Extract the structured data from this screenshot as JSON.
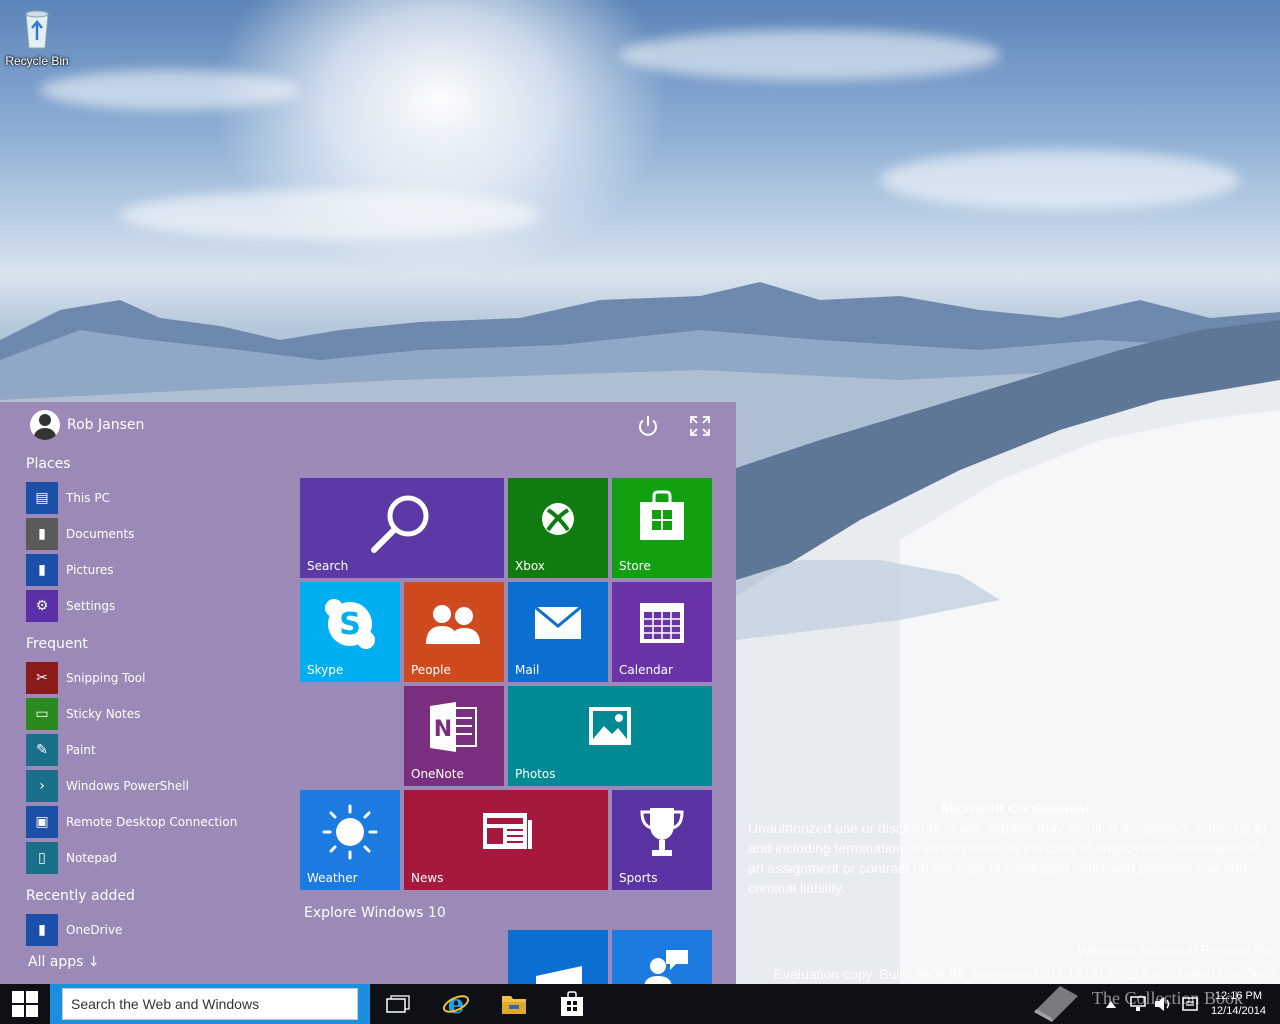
{
  "desktop": {
    "recycle_bin_label": "Recycle Bin",
    "watermark": {
      "title": "Microsoft Confidential",
      "body": "Unauthorized use or disclosure in any manner may result in disciplinary action up to and including termination of employment (in the case of employees), termination of an assignment or contract (in the case of contingent staff), and potential civil and criminal liability."
    },
    "build_line1": "Windows Technical Preview Pro",
    "build_line2": "Evaluation copy. Build 9909.fbl_awesome1501.141213-2119.d251e8ed37a50bc9",
    "brand_text": "The Collection Book"
  },
  "start_menu": {
    "user_name": "Rob Jansen",
    "background": "#9c89b7",
    "places_heading": "Places",
    "places": [
      {
        "label": "This PC",
        "icon": "computer-icon",
        "color": "#1c4fa8"
      },
      {
        "label": "Documents",
        "icon": "documents-icon",
        "color": "#5a5a5a"
      },
      {
        "label": "Pictures",
        "icon": "pictures-icon",
        "color": "#1c4fa8"
      },
      {
        "label": "Settings",
        "icon": "gear-icon",
        "color": "#5b2fa6"
      }
    ],
    "frequent_heading": "Frequent",
    "frequent": [
      {
        "label": "Snipping Tool",
        "icon": "scissors-icon",
        "color": "#8b1a1a"
      },
      {
        "label": "Sticky Notes",
        "icon": "sticky-note-icon",
        "color": "#2b8a1e"
      },
      {
        "label": "Paint",
        "icon": "palette-icon",
        "color": "#1c6f8a"
      },
      {
        "label": "Windows PowerShell",
        "icon": "powershell-icon",
        "color": "#1c6f8a"
      },
      {
        "label": "Remote Desktop Connection",
        "icon": "remote-desktop-icon",
        "color": "#1c4fa8"
      },
      {
        "label": "Notepad",
        "icon": "notepad-icon",
        "color": "#1c6f8a"
      }
    ],
    "recent_heading": "Recently added",
    "recent": [
      {
        "label": "OneDrive",
        "icon": "onedrive-icon",
        "color": "#1c4fa8"
      }
    ],
    "all_apps_label": "All apps ↓",
    "explore_label": "Explore Windows 10",
    "tiles": [
      {
        "label": "Search",
        "icon": "search-icon",
        "color": "#5b3aa6"
      },
      {
        "label": "Xbox",
        "icon": "xbox-icon",
        "color": "#107c10"
      },
      {
        "label": "Store",
        "icon": "store-icon",
        "color": "#10a010"
      },
      {
        "label": "Skype",
        "icon": "skype-icon",
        "color": "#00aff0"
      },
      {
        "label": "People",
        "icon": "people-icon",
        "color": "#d04a20"
      },
      {
        "label": "Mail",
        "icon": "mail-icon",
        "color": "#0a6fd0"
      },
      {
        "label": "Calendar",
        "icon": "calendar-icon",
        "color": "#6a34a8"
      },
      {
        "label": "OneNote",
        "icon": "onenote-icon",
        "color": "#7a2f7e"
      },
      {
        "label": "Photos",
        "icon": "photos-icon",
        "color": "#008a94"
      },
      {
        "label": "Weather",
        "icon": "weather-icon",
        "color": "#1b7be0"
      },
      {
        "label": "News",
        "icon": "news-icon",
        "color": "#a51a3c"
      },
      {
        "label": "Sports",
        "icon": "trophy-icon",
        "color": "#5b34a4"
      }
    ]
  },
  "taskbar": {
    "search_placeholder": "Search the Web and Windows",
    "clock_time": "12:16 PM",
    "clock_date": "12/14/2014"
  }
}
